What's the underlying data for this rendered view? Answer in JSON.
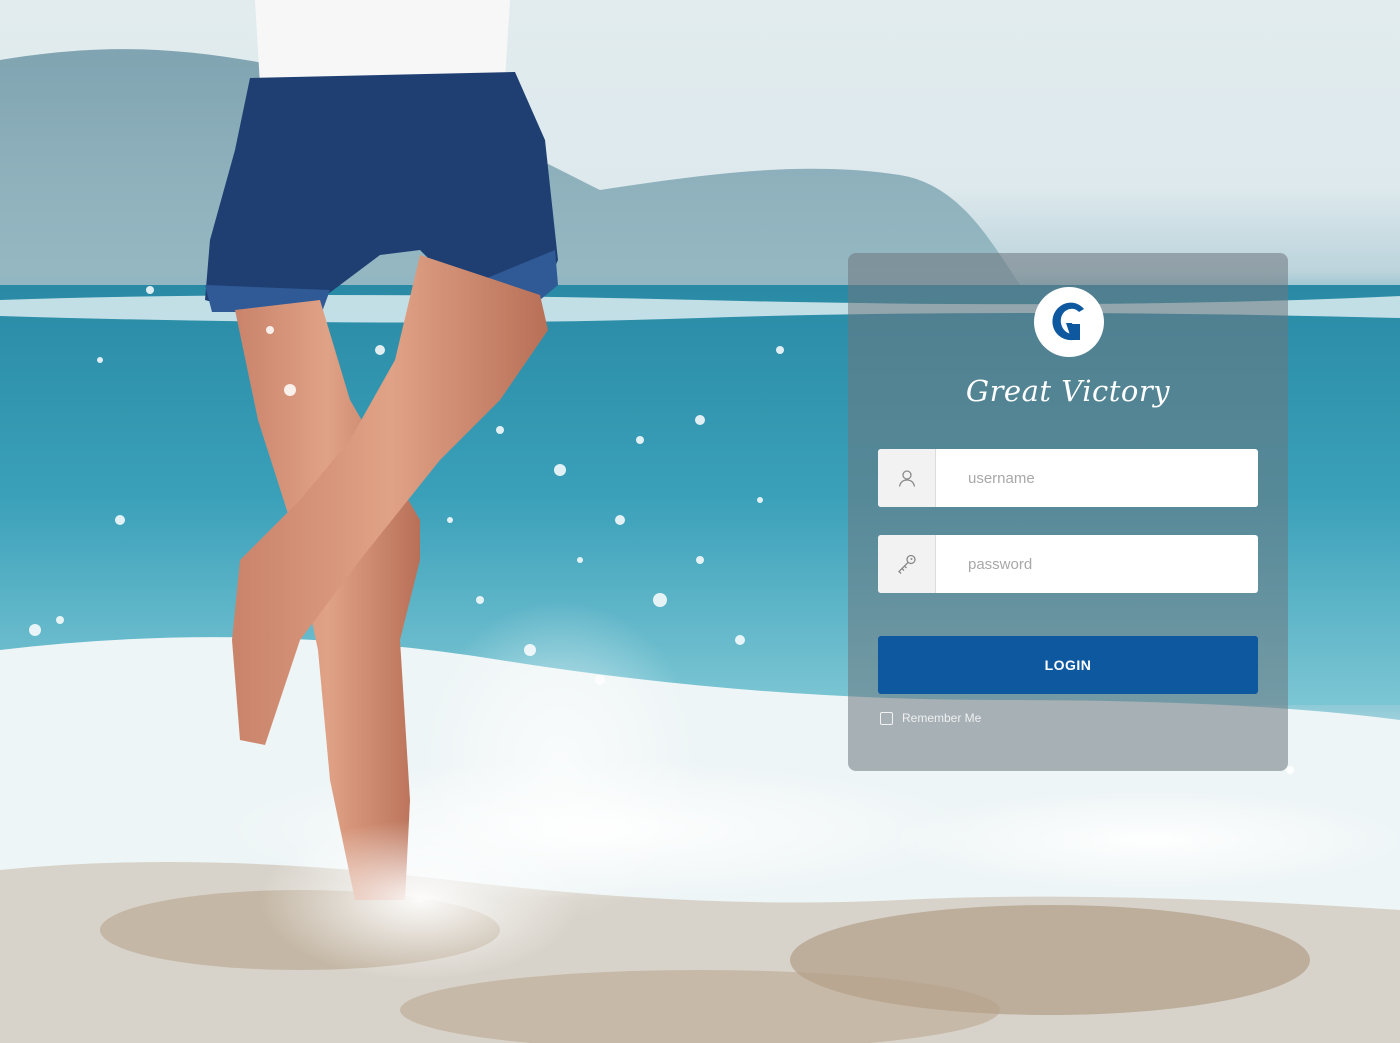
{
  "brand": {
    "name": "Great Victory",
    "logo_icon": "g-logo-icon",
    "accent_color": "#0e58a0"
  },
  "login_form": {
    "username": {
      "placeholder": "username",
      "value": "",
      "icon": "user-icon"
    },
    "password": {
      "placeholder": "password",
      "value": "",
      "icon": "key-icon"
    },
    "submit_label": "LOGIN",
    "remember_me": {
      "label": "Remember Me",
      "checked": false
    }
  },
  "background": {
    "subject": "beach-splash-photo"
  }
}
